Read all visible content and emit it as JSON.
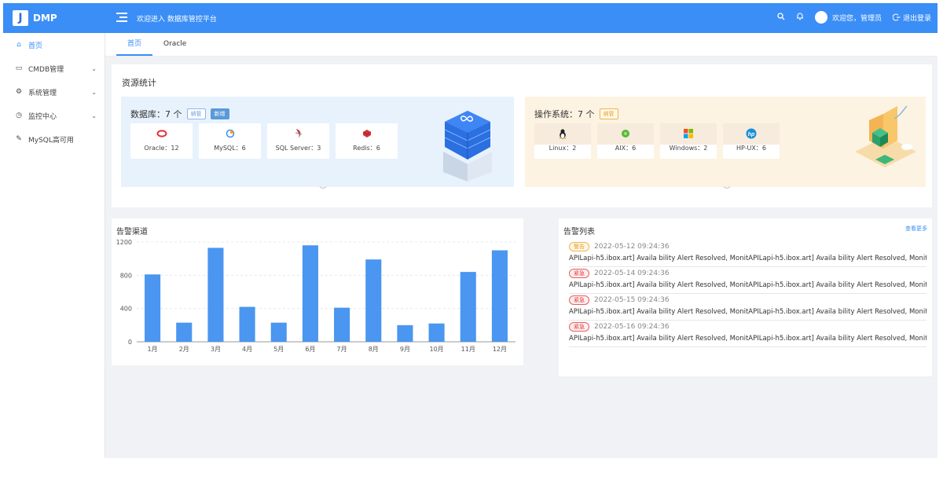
{
  "app": {
    "logo_letter": "J",
    "name": "DMP",
    "welcome": "欢迎进入 数据库管控平台"
  },
  "header": {
    "user_greeting": "欢迎您，管理员",
    "logout_label": "退出登录"
  },
  "sidebar": {
    "items": [
      {
        "label": "首页",
        "icon": "home-icon",
        "active": true
      },
      {
        "label": "CMDB管理",
        "icon": "monitor-icon",
        "has_children": true
      },
      {
        "label": "系统管理",
        "icon": "gear-icon",
        "has_children": true
      },
      {
        "label": "监控中心",
        "icon": "clock-icon",
        "has_children": true
      },
      {
        "label": "MySQL高可用",
        "icon": "edit-icon"
      }
    ]
  },
  "tabs": [
    {
      "label": "首页",
      "active": true
    },
    {
      "label": "Oracle"
    }
  ],
  "resources": {
    "title": "资源统计",
    "database": {
      "heading": "数据库：7 个",
      "tag_manage": "纳管",
      "tag_add": "新增",
      "items": [
        {
          "label": "Oracle：12",
          "icon": "oracle-icon"
        },
        {
          "label": "MySQL：6",
          "icon": "mysql-icon"
        },
        {
          "label": "SQL Server：3",
          "icon": "sqlserver-icon"
        },
        {
          "label": "Redis：6",
          "icon": "redis-icon"
        }
      ]
    },
    "os": {
      "heading": "操作系统：7 个",
      "tag_manage": "纳管",
      "items": [
        {
          "label": "Linux：2",
          "icon": "linux-icon"
        },
        {
          "label": "AIX：6",
          "icon": "aix-icon"
        },
        {
          "label": "Windows：2",
          "icon": "windows-icon"
        },
        {
          "label": "HP-UX：6",
          "icon": "hp-icon"
        }
      ]
    }
  },
  "chart_data": {
    "type": "bar",
    "title": "告警渠道",
    "categories": [
      "1月",
      "2月",
      "3月",
      "4月",
      "5月",
      "6月",
      "7月",
      "8月",
      "9月",
      "10月",
      "11月",
      "12月"
    ],
    "values": [
      810,
      230,
      1130,
      420,
      230,
      1160,
      410,
      990,
      200,
      220,
      840,
      1100
    ],
    "ylim": [
      0,
      1200
    ],
    "yticks": [
      0,
      400,
      800,
      1200
    ],
    "grid": true,
    "bar_color": "#4a96f0"
  },
  "alerts": {
    "title": "告警列表",
    "more": "查看更多",
    "items": [
      {
        "level": "警告",
        "level_type": "warn",
        "time": "2022-05-12 09:24:36",
        "message": "APILapi-h5.ibox.art] Availa bility Alert Resolved, MonitAPILapi-h5.ibox.art] Availa bility Alert Resolved, Monit"
      },
      {
        "level": "紧急",
        "level_type": "urgent",
        "time": "2022-05-14 09:24:36",
        "message": "APILapi-h5.ibox.art] Availa bility Alert Resolved, MonitAPILapi-h5.ibox.art] Availa bility Alert Resolved, Monit"
      },
      {
        "level": "紧急",
        "level_type": "urgent",
        "time": "2022-05-15 09:24:36",
        "message": "APILapi-h5.ibox.art] Availa bility Alert Resolved, MonitAPILapi-h5.ibox.art] Availa bility Alert Resolved, Monit"
      },
      {
        "level": "紧急",
        "level_type": "urgent",
        "time": "2022-05-16 09:24:36",
        "message": "APILapi-h5.ibox.art] Availa bility Alert Resolved, MonitAPILapi-h5.ibox.art] Availa bility Alert Resolved, Monit"
      }
    ]
  }
}
